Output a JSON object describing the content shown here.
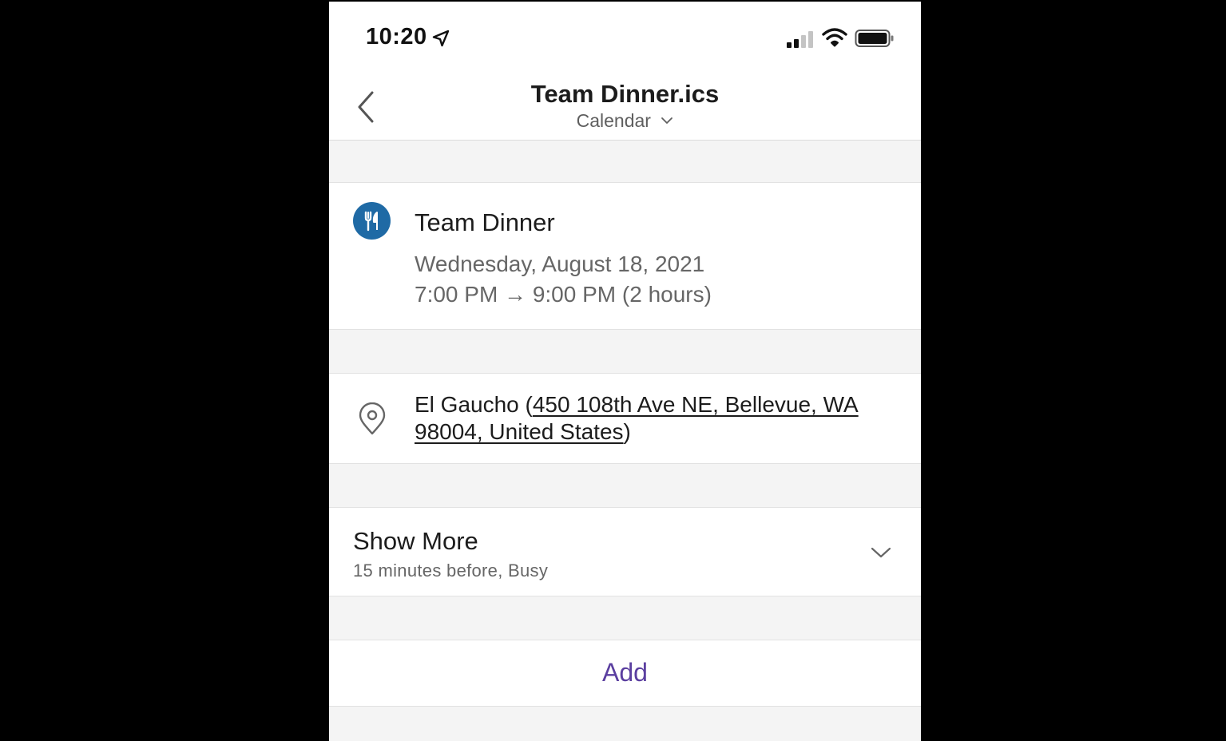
{
  "status_bar": {
    "time": "10:20",
    "location_icon": "location-arrow-icon",
    "signal_icon": "cellular-signal-icon",
    "wifi_icon": "wifi-icon",
    "battery_icon": "battery-icon"
  },
  "nav": {
    "back_icon": "chevron-left-icon",
    "title": "Team Dinner.ics",
    "subtitle": "Calendar",
    "subtitle_icon": "chevron-down-icon"
  },
  "event": {
    "icon": "fork-knife-icon",
    "icon_color": "#1f6aa5",
    "title": "Team Dinner",
    "date": "Wednesday, August 18, 2021",
    "time_range": "7:00 PM → 9:00 PM (2 hours)"
  },
  "location": {
    "icon": "location-pin-icon",
    "name": "El Gaucho (",
    "address": "450 108th Ave NE, Bellevue, WA 98004, United States",
    "suffix": ")"
  },
  "show_more": {
    "title": "Show More",
    "subtitle": "15 minutes before, Busy",
    "icon": "chevron-down-icon"
  },
  "actions": {
    "add_label": "Add",
    "add_color": "#5b3fa0"
  }
}
